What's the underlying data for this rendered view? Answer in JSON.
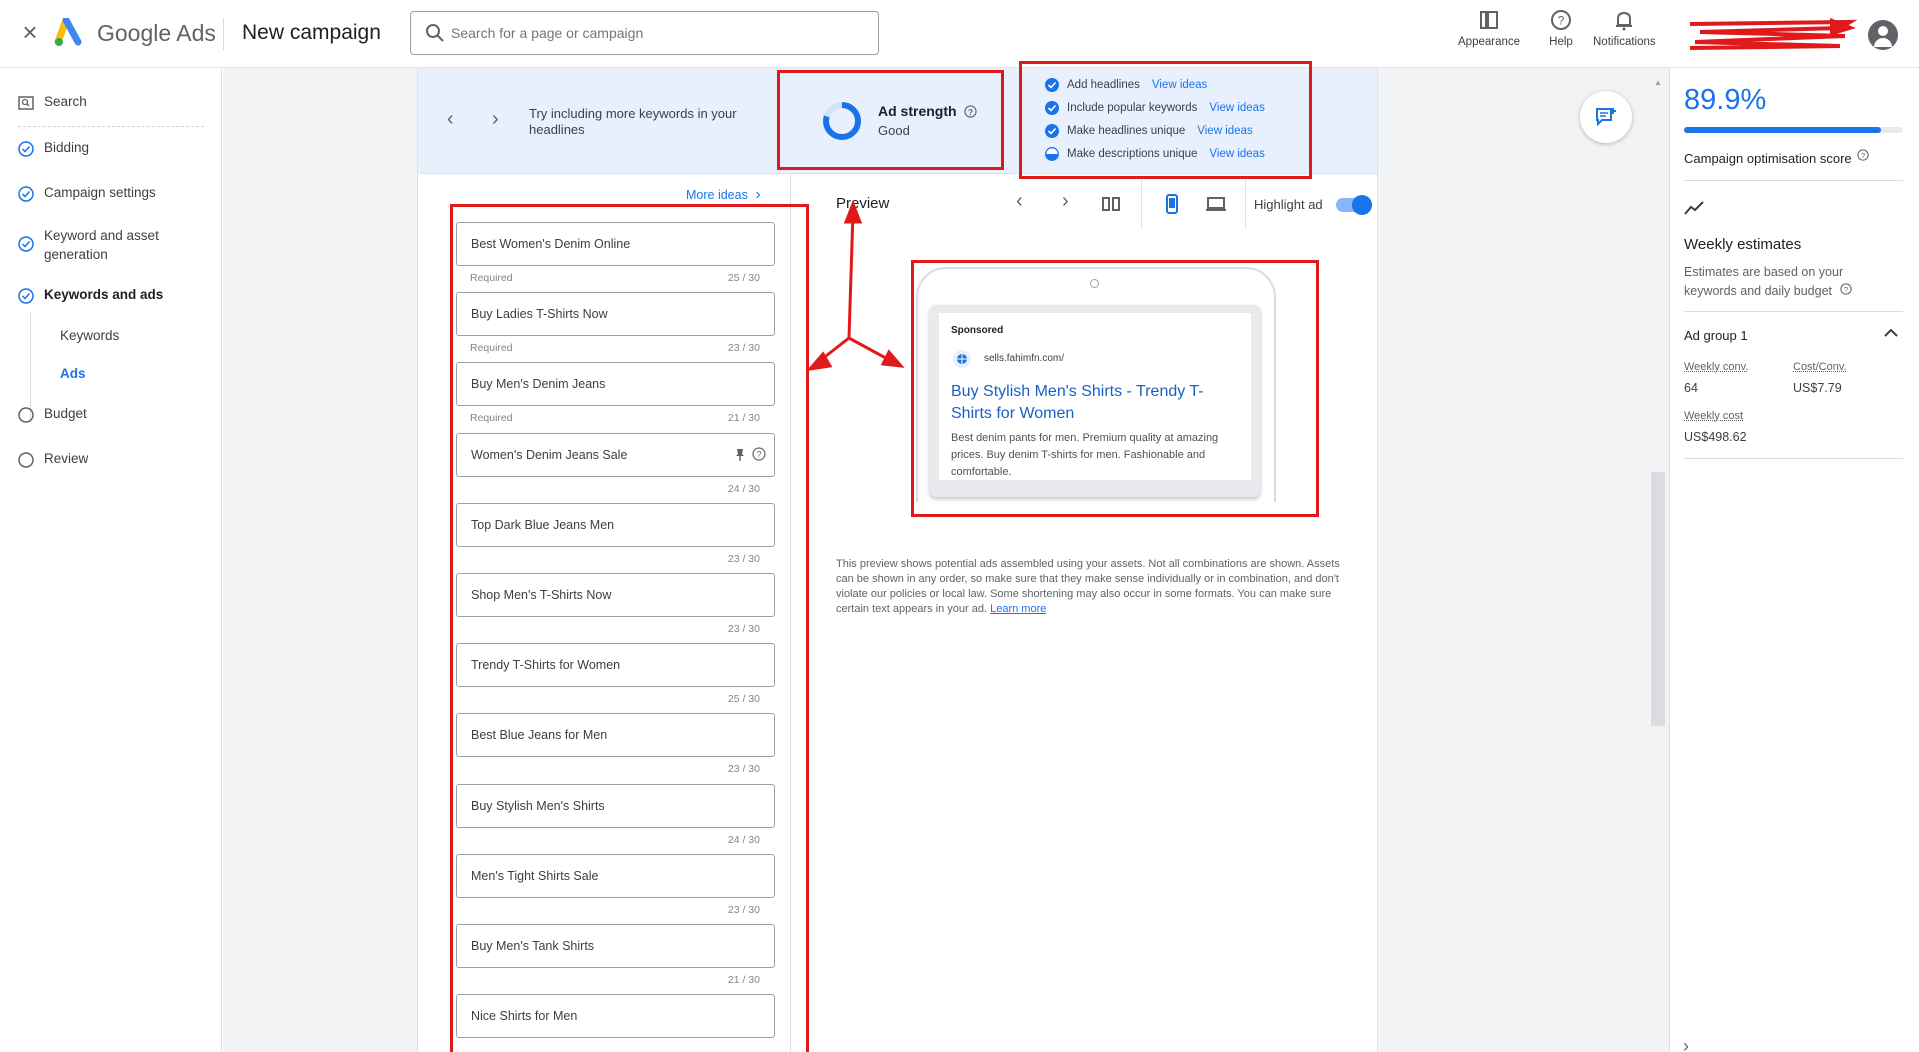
{
  "header": {
    "brand": "Google Ads",
    "page_title": "New campaign",
    "search_placeholder": "Search for a page or campaign",
    "actions": [
      {
        "label": "Appearance",
        "icon": "appearance-icon"
      },
      {
        "label": "Help",
        "icon": "help-icon"
      },
      {
        "label": "Notifications",
        "icon": "bell-icon"
      }
    ]
  },
  "leftnav": {
    "items": [
      {
        "label": "Search",
        "icon": "search-campaign-icon",
        "state": "neutral"
      },
      {
        "label": "Bidding",
        "icon": "check-circle-icon",
        "state": "done"
      },
      {
        "label": "Campaign settings",
        "icon": "check-circle-icon",
        "state": "done"
      },
      {
        "label": "Keyword and asset generation",
        "icon": "check-circle-icon",
        "state": "done"
      },
      {
        "label": "Keywords and ads",
        "icon": "check-circle-icon",
        "state": "active"
      },
      {
        "label": "Budget",
        "icon": "empty-circle-icon",
        "state": "todo"
      },
      {
        "label": "Review",
        "icon": "empty-circle-icon",
        "state": "todo"
      }
    ],
    "subitems": [
      {
        "label": "Keywords",
        "selected": false
      },
      {
        "label": "Ads",
        "selected": true
      }
    ]
  },
  "strength": {
    "tip": "Try including more keywords in your headlines",
    "title": "Ad strength",
    "value": "Good",
    "checklist": [
      {
        "label": "Add headlines",
        "link": "View ideas",
        "state": "done"
      },
      {
        "label": "Include popular keywords",
        "link": "View ideas",
        "state": "done"
      },
      {
        "label": "Make headlines unique",
        "link": "View ideas",
        "state": "done"
      },
      {
        "label": "Make descriptions unique",
        "link": "View ideas",
        "state": "partial"
      }
    ]
  },
  "headlines": {
    "more_ideas": "More ideas",
    "items": [
      {
        "text": "Best Women's Denim Online",
        "required": "Required",
        "count": "25 / 30"
      },
      {
        "text": "Buy Ladies T-Shirts Now",
        "required": "Required",
        "count": "23 / 30"
      },
      {
        "text": "Buy Men's Denim Jeans",
        "required": "Required",
        "count": "21 / 30"
      },
      {
        "text": "Women's Denim Jeans Sale",
        "required": "",
        "count": "24 / 30"
      },
      {
        "text": "Top Dark Blue Jeans Men",
        "required": "",
        "count": "23 / 30"
      },
      {
        "text": "Shop Men's T-Shirts Now",
        "required": "",
        "count": "23 / 30"
      },
      {
        "text": "Trendy T-Shirts for Women",
        "required": "",
        "count": "25 / 30"
      },
      {
        "text": "Best Blue Jeans for Men",
        "required": "",
        "count": "23 / 30"
      },
      {
        "text": "Buy Stylish Men's Shirts",
        "required": "",
        "count": "24 / 30"
      },
      {
        "text": "Men's Tight Shirts Sale",
        "required": "",
        "count": "23 / 30"
      },
      {
        "text": "Buy Men's Tank Shirts",
        "required": "",
        "count": "21 / 30"
      },
      {
        "text": "Nice Shirts for Men",
        "required": "",
        "count": ""
      }
    ]
  },
  "preview": {
    "label": "Preview",
    "highlight_label": "Highlight ad",
    "highlight_on": true,
    "ad": {
      "sponsored": "Sponsored",
      "url": "sells.fahimfn.com/",
      "headline": "Buy Stylish Men's Shirts - Trendy T-Shirts for Women",
      "description": "Best denim pants for men. Premium quality at amazing prices. Buy denim T-shirts for men. Fashionable and comfortable."
    },
    "note": "This preview shows potential ads assembled using your assets. Not all combinations are shown. Assets can be shown in any order, so make sure that they make sense individually or in combination, and don't violate our policies or local law. Some shortening may also occur in some formats. You can make sure certain text appears in your ad.",
    "note_link": "Learn more"
  },
  "rightpanel": {
    "score": "89.9%",
    "score_fraction": 0.899,
    "score_label": "Campaign optimisation score",
    "weekly_title": "Weekly estimates",
    "weekly_sub": "Estimates are based on your keywords and daily budget",
    "ad_group": "Ad group 1",
    "metrics": [
      {
        "label": "Weekly conv.",
        "value": "64"
      },
      {
        "label": "Cost/Conv.",
        "value": "US$7.79"
      },
      {
        "label": "Weekly cost",
        "value": "US$498.62"
      }
    ]
  },
  "colors": {
    "accent": "#1a73e8",
    "annotation_red": "#e0191b"
  }
}
